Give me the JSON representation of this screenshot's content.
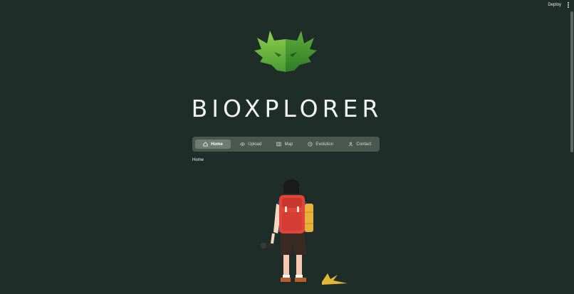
{
  "topbar": {
    "deploy_label": "Deploy",
    "menu_icon": "kebab-icon"
  },
  "brand": {
    "name": "BIOXPLORER",
    "logo_icon": "bioxplorer-logo"
  },
  "nav": {
    "items": [
      {
        "label": "Home",
        "icon": "home-icon",
        "active": true
      },
      {
        "label": "Upload",
        "icon": "eye-icon",
        "active": false
      },
      {
        "label": "Map",
        "icon": "map-icon",
        "active": false
      },
      {
        "label": "Evolution",
        "icon": "clock-icon",
        "active": false
      },
      {
        "label": "Contact",
        "icon": "person-icon",
        "active": false
      }
    ]
  },
  "breadcrumb": {
    "current": "Home"
  },
  "colors": {
    "background": "#1e2d28",
    "nav_background": "#4b5852",
    "nav_active": "#6e7c76",
    "logo_green_light": "#8fcf4e",
    "logo_green_dark": "#3e8f2e"
  }
}
